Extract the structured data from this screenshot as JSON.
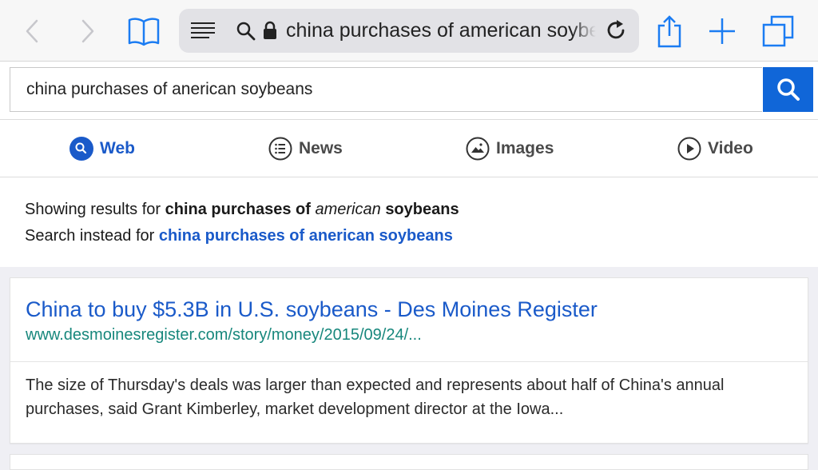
{
  "browser": {
    "url_text": "china purchases of american soybeans",
    "colors": {
      "accent": "#1b7cf2",
      "disabled": "#c7c7cc"
    }
  },
  "search": {
    "query": "china purchases of anerican soybeans",
    "button_color": "#1066d8"
  },
  "tabs": [
    {
      "label": "Web",
      "icon": "search-icon",
      "active": true
    },
    {
      "label": "News",
      "icon": "list-icon",
      "active": false
    },
    {
      "label": "Images",
      "icon": "image-icon",
      "active": false
    },
    {
      "label": "Video",
      "icon": "play-icon",
      "active": false
    }
  ],
  "spelling": {
    "showing_prefix": "Showing results for",
    "showing_part1": "china purchases of",
    "showing_italic": "american",
    "showing_part2": "soybeans",
    "instead_prefix": "Search instead for",
    "instead_link": "china purchases of anerican soybeans"
  },
  "results": [
    {
      "title": "China to buy $5.3B in U.S. soybeans - Des Moines Register",
      "url": "www.desmoinesregister.com/story/money/2015/09/24/...",
      "snippet": "The size of Thursday's deals was larger than expected and represents about half of China's annual purchases, said Grant Kimberley, market development director at the Iowa..."
    }
  ]
}
